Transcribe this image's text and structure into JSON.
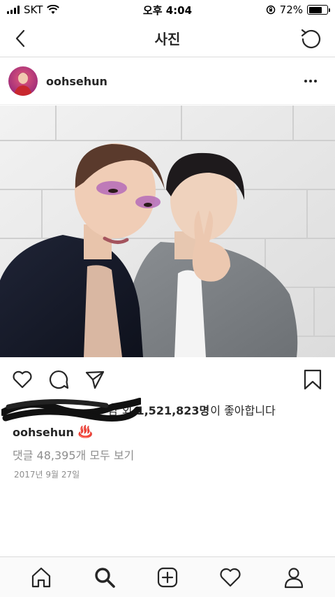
{
  "status_bar": {
    "carrier": "SKT",
    "time": "오후 4:04",
    "battery_percent": "72%",
    "battery_level": 0.72
  },
  "header": {
    "title": "사진",
    "back_icon": "chevron-left-icon",
    "refresh_icon": "refresh-icon"
  },
  "post": {
    "username": "oohsehun",
    "more_icon": "ellipsis-icon",
    "likes_names": "님",
    "likes_connector": "외",
    "likes_count": "1,521,823명",
    "likes_suffix": "이 좋아합니다",
    "caption_user": "oohsehun",
    "caption_text": "♨️",
    "comments_link": "댓글 48,395개 모두 보기",
    "date": "2017년 9월 27일"
  },
  "actions": {
    "like_icon": "heart-icon",
    "comment_icon": "comment-icon",
    "share_icon": "send-icon",
    "save_icon": "bookmark-icon"
  },
  "bottom_nav": {
    "items": [
      "home-icon",
      "search-icon",
      "add-icon",
      "activity-heart-icon",
      "profile-icon"
    ]
  },
  "colors": {
    "text": "#262626",
    "muted": "#8e8e8e",
    "border": "#dbdbdb",
    "caption_emoji": "#e4573e"
  }
}
